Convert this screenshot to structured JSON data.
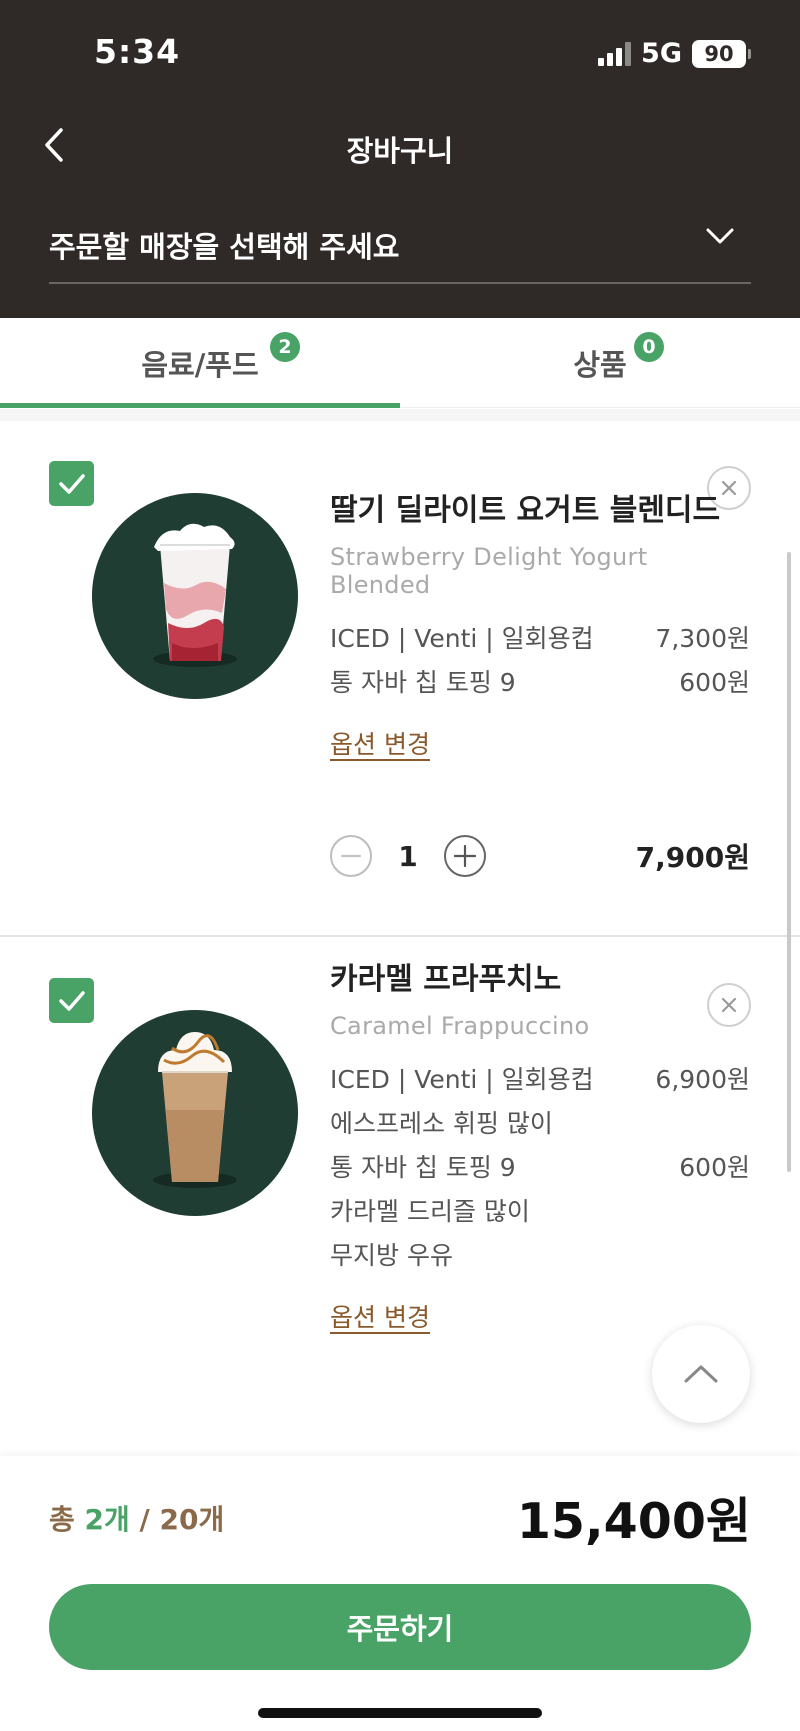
{
  "status": {
    "time": "5:34",
    "network": "5G",
    "battery": "90"
  },
  "header": {
    "title": "장바구니",
    "store_placeholder": "주문할 매장을 선택해 주세요"
  },
  "tabs": [
    {
      "label": "음료/푸드",
      "count": "2",
      "active": true
    },
    {
      "label": "상품",
      "count": "0",
      "active": false
    }
  ],
  "items": [
    {
      "name_ko": "딸기 딜라이트 요거트 블렌디드",
      "name_en": "Strawberry Delight Yogurt Blended",
      "options": [
        {
          "label": "ICED | Venti | 일회용컵",
          "price": "7,300원"
        },
        {
          "label": "통 자바 칩 토핑 9",
          "price": "600원"
        }
      ],
      "option_change": "옵션 변경",
      "quantity": "1",
      "total": "7,900원",
      "checked": true
    },
    {
      "name_ko": "카라멜 프라푸치노",
      "name_en": "Caramel Frappuccino",
      "options": [
        {
          "label": "ICED | Venti | 일회용컵",
          "price": "6,900원"
        },
        {
          "label": "에스프레소 휘핑 많이",
          "price": ""
        },
        {
          "label": "통 자바 칩 토핑 9",
          "price": "600원"
        },
        {
          "label": "카라멜 드리즐 많이",
          "price": ""
        },
        {
          "label": "무지방 우유",
          "price": ""
        }
      ],
      "option_change": "옵션 변경",
      "checked": true
    }
  ],
  "footer": {
    "total_prefix": "총 ",
    "total_selected": "2개",
    "total_max": " / 20개",
    "total_price": "15,400원",
    "order_button": "주문하기"
  },
  "colors": {
    "header_bg": "#2f2a28",
    "accent_green": "#4aa366",
    "thumb_bg": "#1f3d33",
    "link_brown": "#8a5a2c"
  }
}
